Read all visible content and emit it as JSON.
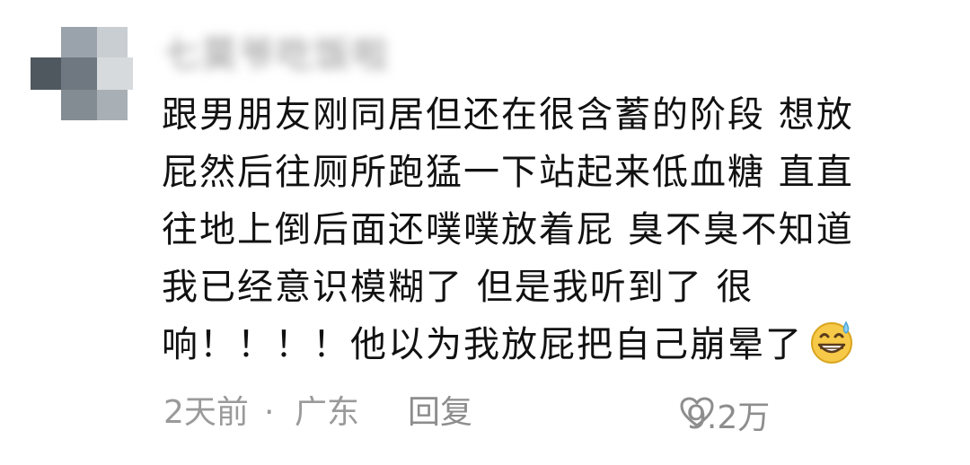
{
  "comment": {
    "username": "七莫爷吃饭啦",
    "lines": [
      "跟男朋友刚同居但还在很含蓄的阶段 想放",
      "屁然后往厕所跑猛一下站起来低血糖 直直",
      "往地上倒后面还噗噗放着屁 臭不臭不知道",
      "我已经意识模糊了 但是我听到了 很",
      "响！！！！他以为我放屁把自己崩晕了"
    ],
    "emoji": "grin-sweat-emoji-icon",
    "time": "2天前",
    "separator": "·",
    "location": "广东",
    "reply_label": "回复",
    "like_icon": "heart-outline-icon",
    "like_count": "9.2万"
  },
  "colors": {
    "text": "#111111",
    "meta": "#9a9a9a",
    "emoji_face": "#f7c948",
    "emoji_sweat": "#8fd0f2"
  }
}
